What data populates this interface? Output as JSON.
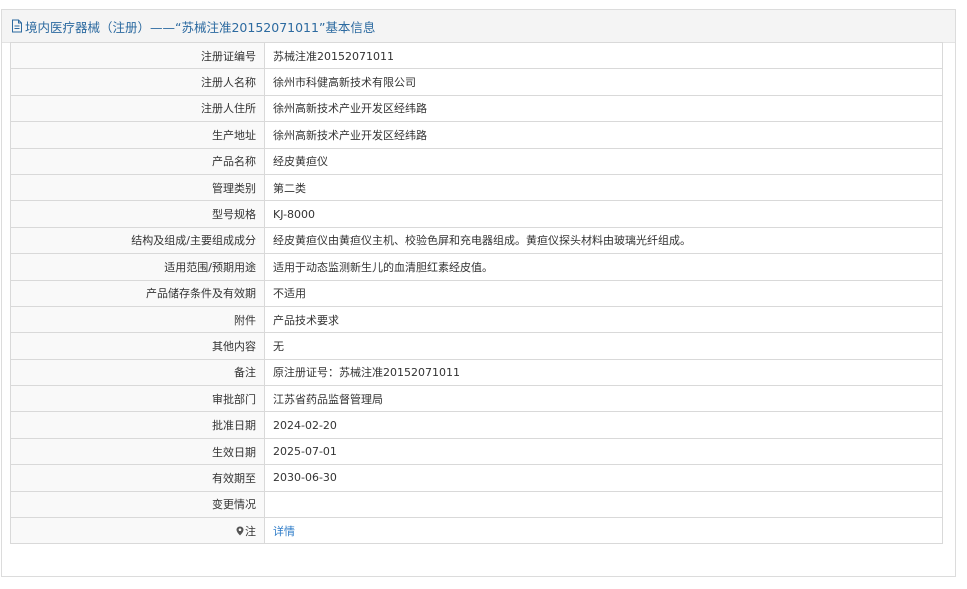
{
  "header": {
    "title": "境内医疗器械（注册）——“苏械注准20152071011”基本信息",
    "icon": "document-icon",
    "color": "#2c6aa0"
  },
  "rows": [
    {
      "label": "注册证编号",
      "value": "苏械注准20152071011"
    },
    {
      "label": "注册人名称",
      "value": "徐州市科健高新技术有限公司"
    },
    {
      "label": "注册人住所",
      "value": "徐州高新技术产业开发区经纬路"
    },
    {
      "label": "生产地址",
      "value": "徐州高新技术产业开发区经纬路"
    },
    {
      "label": "产品名称",
      "value": "经皮黄疸仪"
    },
    {
      "label": "管理类别",
      "value": "第二类"
    },
    {
      "label": "型号规格",
      "value": "KJ-8000"
    },
    {
      "label": "结构及组成/主要组成成分",
      "value": "经皮黄疸仪由黄疸仪主机、校验色屏和充电器组成。黄疸仪探头材料由玻璃光纤组成。"
    },
    {
      "label": "适用范围/预期用途",
      "value": "适用于动态监测新生儿的血清胆红素经皮值。"
    },
    {
      "label": "产品储存条件及有效期",
      "value": "不适用"
    },
    {
      "label": "附件",
      "value": "产品技术要求"
    },
    {
      "label": "其他内容",
      "value": "无"
    },
    {
      "label": "备注",
      "value": "原注册证号：苏械注准20152071011"
    },
    {
      "label": "审批部门",
      "value": "江苏省药品监督管理局"
    },
    {
      "label": "批准日期",
      "value": "2024-02-20"
    },
    {
      "label": "生效日期",
      "value": "2025-07-01"
    },
    {
      "label": "有效期至",
      "value": "2030-06-30"
    },
    {
      "label": "变更情况",
      "value": ""
    }
  ],
  "note_row": {
    "label": "注",
    "icon": "location-pin-icon",
    "link": "详情",
    "link_color": "#2c7bc8"
  }
}
